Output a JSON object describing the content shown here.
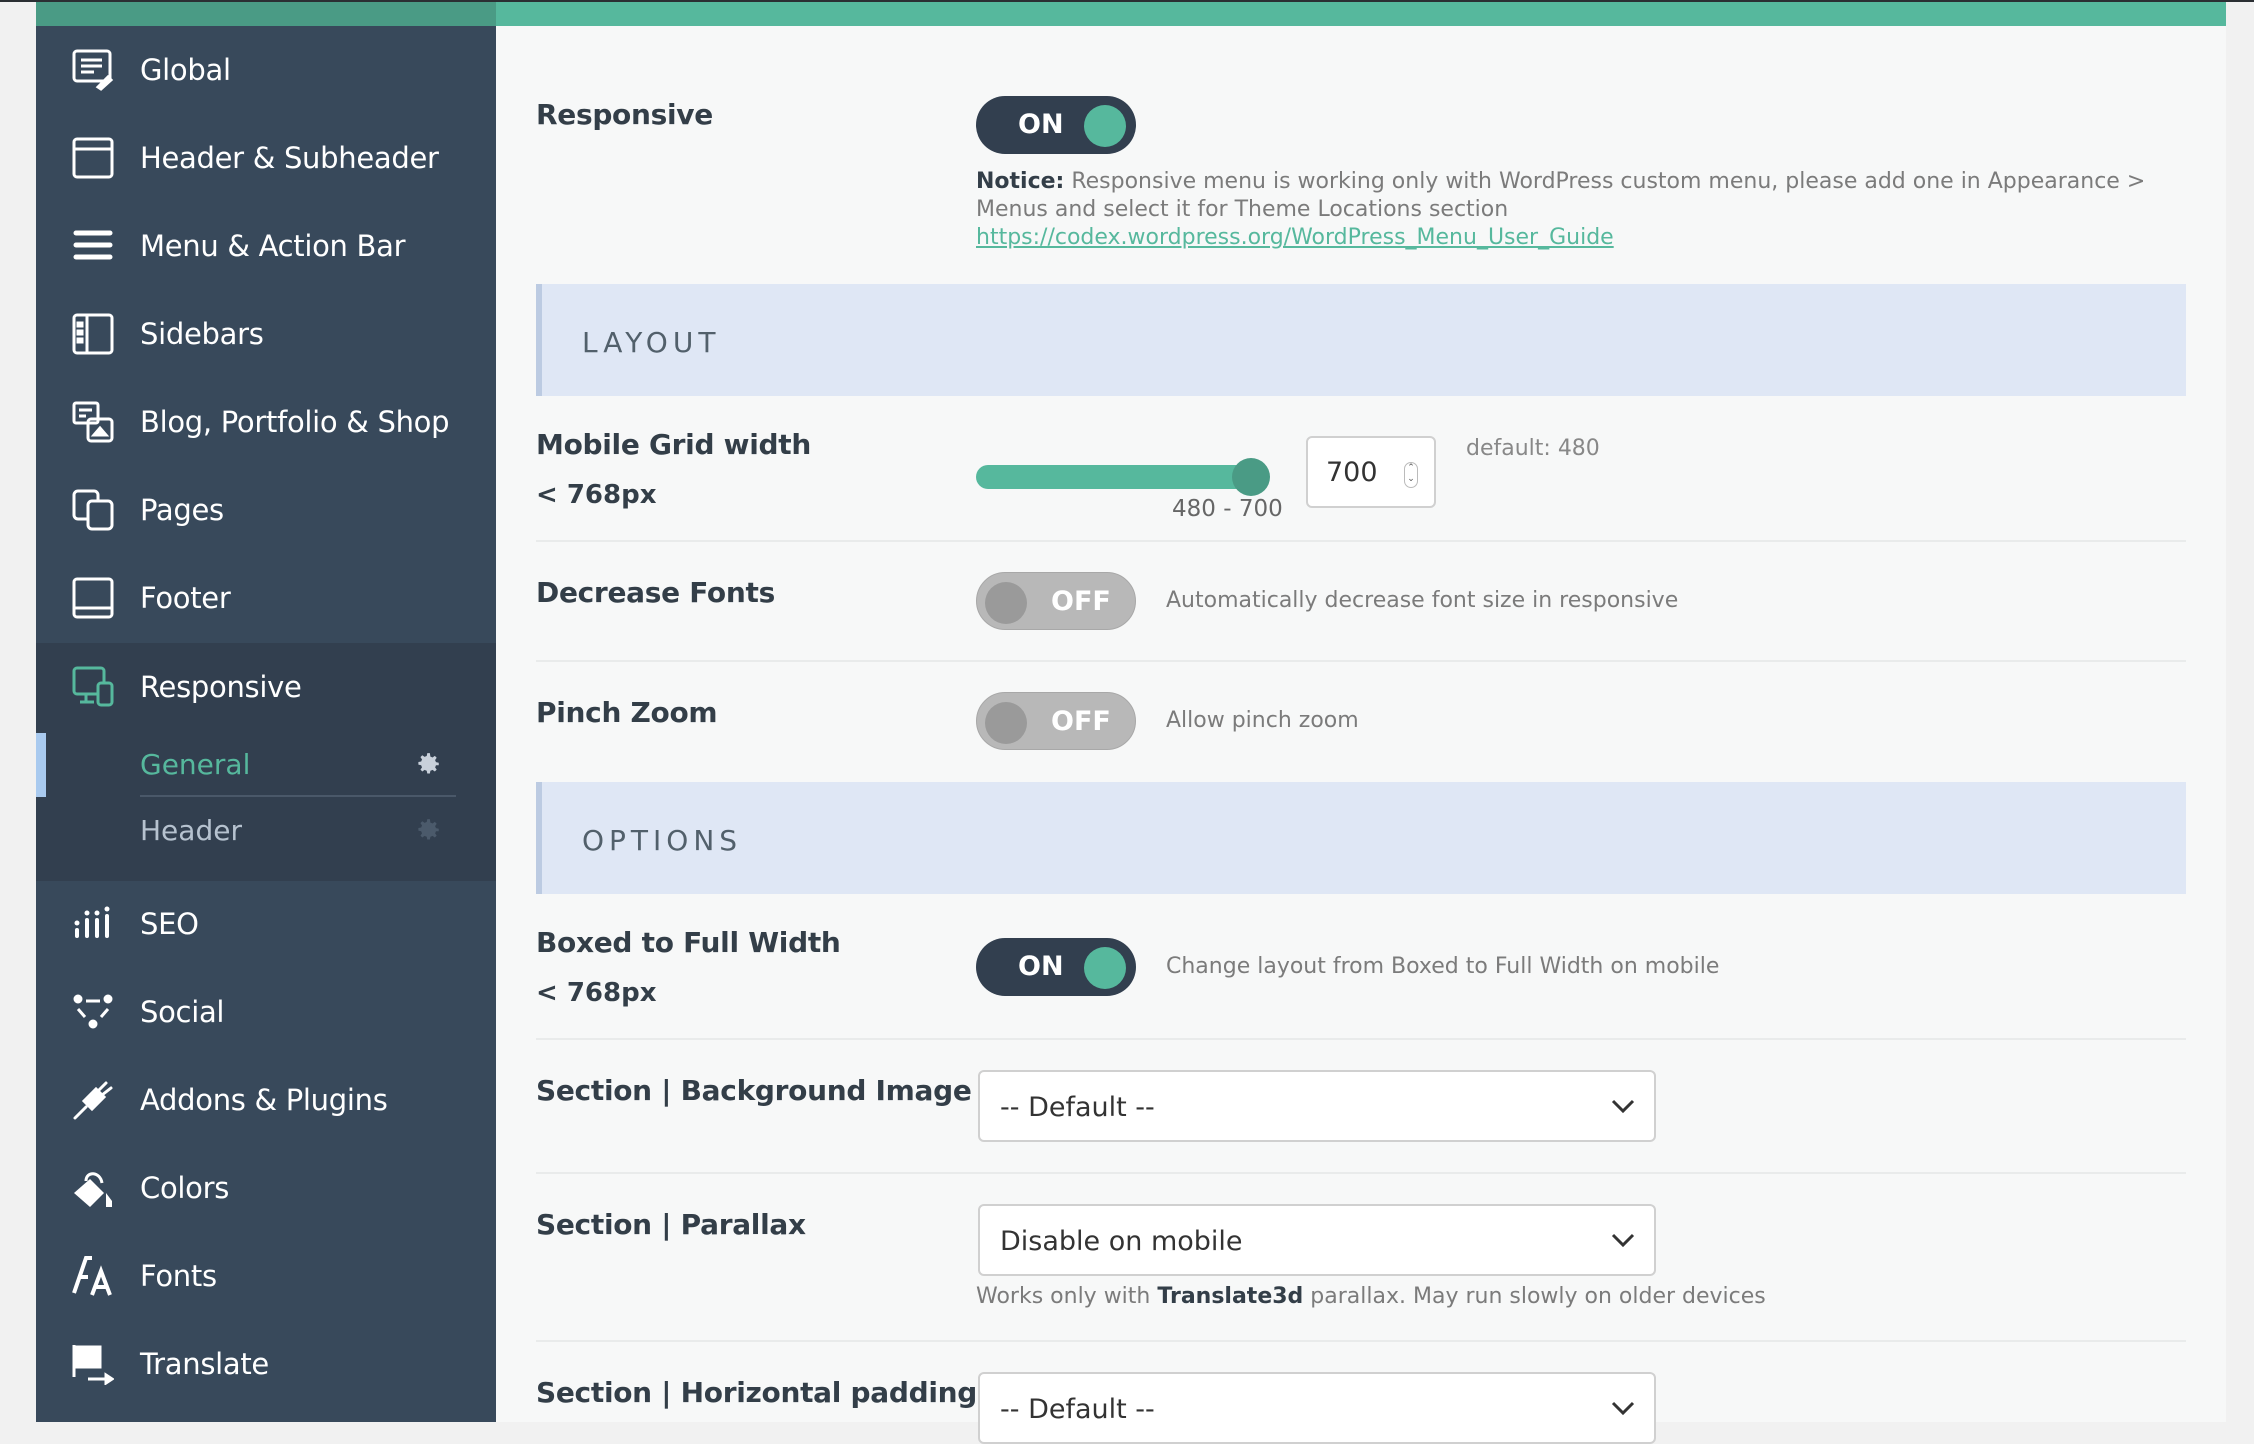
{
  "sidebar": {
    "items": [
      {
        "label": "Global",
        "icon": "global-settings-icon"
      },
      {
        "label": "Header & Subheader",
        "icon": "window-icon"
      },
      {
        "label": "Menu & Action Bar",
        "icon": "menu-icon"
      },
      {
        "label": "Sidebars",
        "icon": "sidebar-icon"
      },
      {
        "label": "Blog, Portfolio & Shop",
        "icon": "blog-icon"
      },
      {
        "label": "Pages",
        "icon": "pages-icon"
      },
      {
        "label": "Footer",
        "icon": "footer-icon"
      },
      {
        "label": "Responsive",
        "icon": "responsive-icon",
        "active": true
      },
      {
        "label": "SEO",
        "icon": "seo-icon"
      },
      {
        "label": "Social",
        "icon": "social-icon"
      },
      {
        "label": "Addons & Plugins",
        "icon": "plug-icon"
      },
      {
        "label": "Colors",
        "icon": "paint-bucket-icon"
      },
      {
        "label": "Fonts",
        "icon": "fonts-icon"
      },
      {
        "label": "Translate",
        "icon": "flag-icon"
      }
    ],
    "subitems": [
      {
        "label": "General",
        "active": true
      },
      {
        "label": "Header",
        "active": false
      }
    ]
  },
  "main": {
    "responsive": {
      "label": "Responsive",
      "toggle": "ON",
      "notice_bold": "Notice:",
      "notice_text": " Responsive menu is working only with WordPress custom menu, please add one in Appearance > Menus and select it for Theme Locations section",
      "notice_link": "https://codex.wordpress.org/WordPress_Menu_User_Guide"
    },
    "layout_section": "LAYOUT",
    "mobile_grid": {
      "label": "Mobile Grid width",
      "sublabel": "< 768px",
      "value": "700",
      "min": 480,
      "max": 700,
      "range_text": "480 - 700",
      "default_text": "default: 480"
    },
    "decrease_fonts": {
      "label": "Decrease Fonts",
      "toggle": "OFF",
      "desc": "Automatically decrease font size in responsive"
    },
    "pinch_zoom": {
      "label": "Pinch Zoom",
      "toggle": "OFF",
      "desc": "Allow pinch zoom"
    },
    "options_section": "OPTIONS",
    "boxed_full": {
      "label": "Boxed to Full Width",
      "sublabel": "< 768px",
      "toggle": "ON",
      "desc": "Change layout from Boxed to Full Width on mobile"
    },
    "bg_image": {
      "label": "Section | Background Image",
      "value": "-- Default --"
    },
    "parallax": {
      "label": "Section | Parallax",
      "value": "Disable on mobile",
      "desc_pre": "Works only with ",
      "desc_bold": "Translate3d",
      "desc_post": " parallax. May run slowly on older devices"
    },
    "h_padding": {
      "label": "Section | Horizontal padding",
      "value": "-- Default --"
    }
  },
  "colors": {
    "accent": "#56b89d",
    "sidebar": "#38495b",
    "toggle_on": "#323f4f"
  }
}
